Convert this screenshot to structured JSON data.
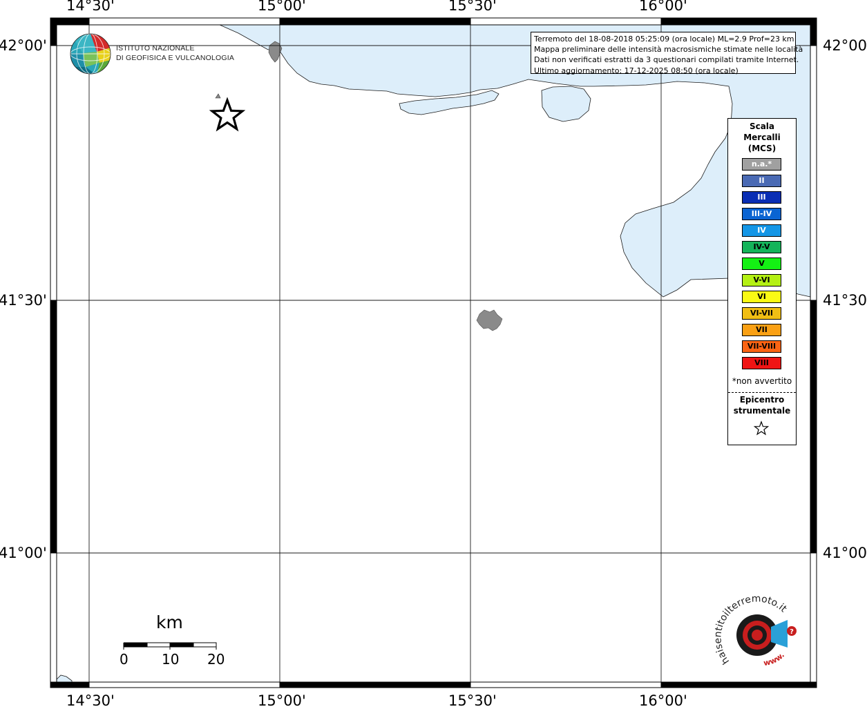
{
  "map": {
    "longitude_labels": [
      "14°30'",
      "15°00'",
      "15°30'",
      "16°00'"
    ],
    "latitude_labels": [
      "42°00'",
      "41°30'",
      "41°00'"
    ],
    "sea_color": "#ddeefa",
    "land_color": "#ffffff",
    "island_color": "#8a8a8a"
  },
  "info": {
    "line1": "Terremoto del 18-08-2018 05:25:09 (ora locale) ML=2.9 Prof=23 km",
    "line2": "Mappa preliminare delle intensità macrosismiche stimate nelle località",
    "line3": "Dati non verificati estratti da 3 questionari compilati tramite Internet.",
    "line4": "Ultimo aggiornamento: 17-12-2025 08:50 (ora locale)"
  },
  "legend": {
    "title_line1": "Scala",
    "title_line2": "Mercalli",
    "title_line3": "(MCS)",
    "items": [
      {
        "label": "n.a.*",
        "color": "#a0a0a0",
        "text_color": "#ffffff"
      },
      {
        "label": "II",
        "color": "#4a6ab4",
        "text_color": "#ffffff"
      },
      {
        "label": "III",
        "color": "#0a2eb4",
        "text_color": "#ffffff"
      },
      {
        "label": "III-IV",
        "color": "#0a64d2",
        "text_color": "#ffffff"
      },
      {
        "label": "IV",
        "color": "#1496e6",
        "text_color": "#ffffff"
      },
      {
        "label": "IV-V",
        "color": "#14b45a",
        "text_color": "#000000"
      },
      {
        "label": "V",
        "color": "#14f014",
        "text_color": "#000000"
      },
      {
        "label": "V-VI",
        "color": "#b4f014",
        "text_color": "#000000"
      },
      {
        "label": "VI",
        "color": "#fafa14",
        "text_color": "#000000"
      },
      {
        "label": "VI-VII",
        "color": "#f0be14",
        "text_color": "#000000"
      },
      {
        "label": "VII",
        "color": "#faa014",
        "text_color": "#000000"
      },
      {
        "label": "VII-VIII",
        "color": "#fa6414",
        "text_color": "#000000"
      },
      {
        "label": "VIII",
        "color": "#f01414",
        "text_color": "#000000"
      }
    ],
    "note": "*non avvertito",
    "epicenter_line1": "Epicentro",
    "epicenter_line2": "strumentale"
  },
  "logo": {
    "line1": "ISTITUTO NAZIONALE",
    "line2": "DI GEOFISICA E VULCANOLOGIA"
  },
  "scale_bar": {
    "unit": "km",
    "ticks": [
      "0",
      "10",
      "20"
    ]
  },
  "hsit": {
    "text": "haisentitoilterremoto.it",
    "www": "www."
  }
}
